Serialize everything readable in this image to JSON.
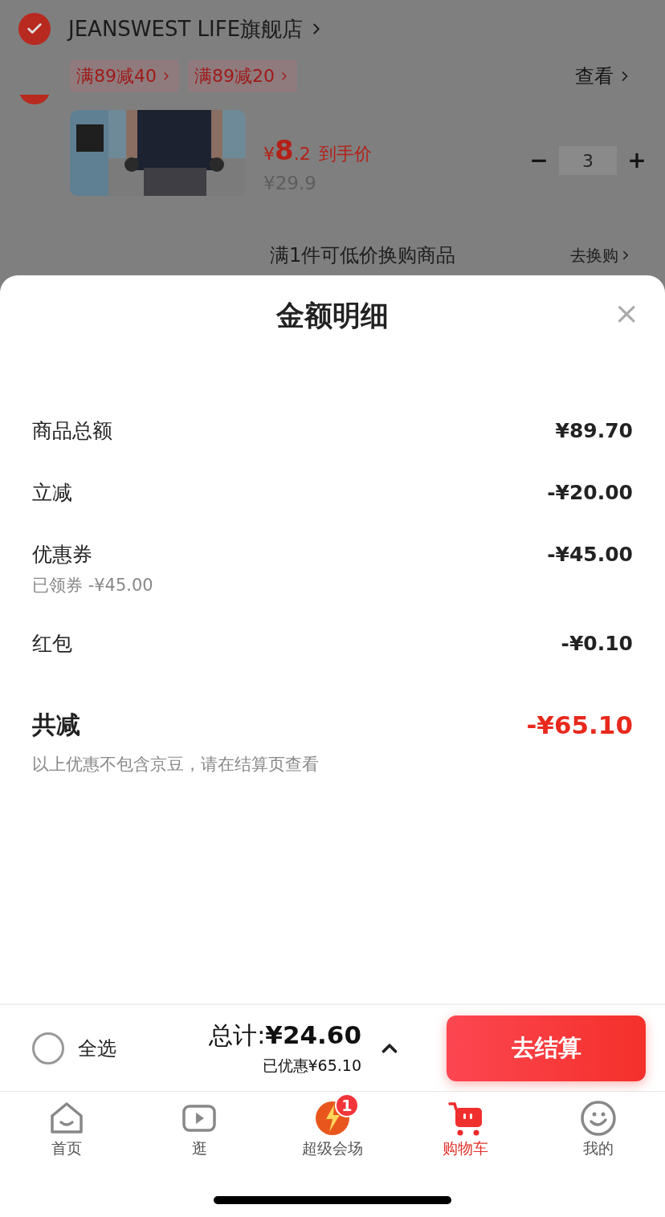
{
  "store": {
    "name": "JEANSWEST LIFE旗舰店",
    "selected": true
  },
  "promos": [
    "满89减40",
    "满89减20"
  ],
  "view_link": "查看",
  "product": {
    "selected": true,
    "price_symbol": "¥",
    "price_int": "8",
    "price_dec": ".2",
    "price_note": "到手价",
    "original_price": "¥29.9",
    "quantity": "3",
    "minus": "−",
    "plus": "+"
  },
  "exchange": {
    "text": "满1件可低价换购商品",
    "link": "去换购"
  },
  "sheet": {
    "title": "金额明细",
    "close": "×",
    "rows": [
      {
        "label": "商品总额",
        "value": "¥89.70"
      },
      {
        "label": "立减",
        "value": "-¥20.00"
      },
      {
        "label": "优惠券",
        "value": "-¥45.00",
        "note": "已领券 -¥45.00"
      },
      {
        "label": "红包",
        "value": "-¥0.10"
      }
    ],
    "total": {
      "label": "共减",
      "value": "-¥65.10"
    },
    "footnote": "以上优惠不包含京豆，请在结算页查看"
  },
  "checkout": {
    "select_all": {
      "label": "全选",
      "checked": false
    },
    "total_label": "总计:",
    "total": "¥24.60",
    "saved": "已优惠¥65.10",
    "button": "去结算"
  },
  "tabs": [
    {
      "kind": "home",
      "label": "首页",
      "selected": false
    },
    {
      "kind": "video",
      "label": "逛",
      "selected": false
    },
    {
      "kind": "venue",
      "label": "超级会场",
      "selected": false,
      "badge": "1"
    },
    {
      "kind": "cart",
      "label": "购物车",
      "selected": true
    },
    {
      "kind": "me",
      "label": "我的",
      "selected": false
    }
  ]
}
